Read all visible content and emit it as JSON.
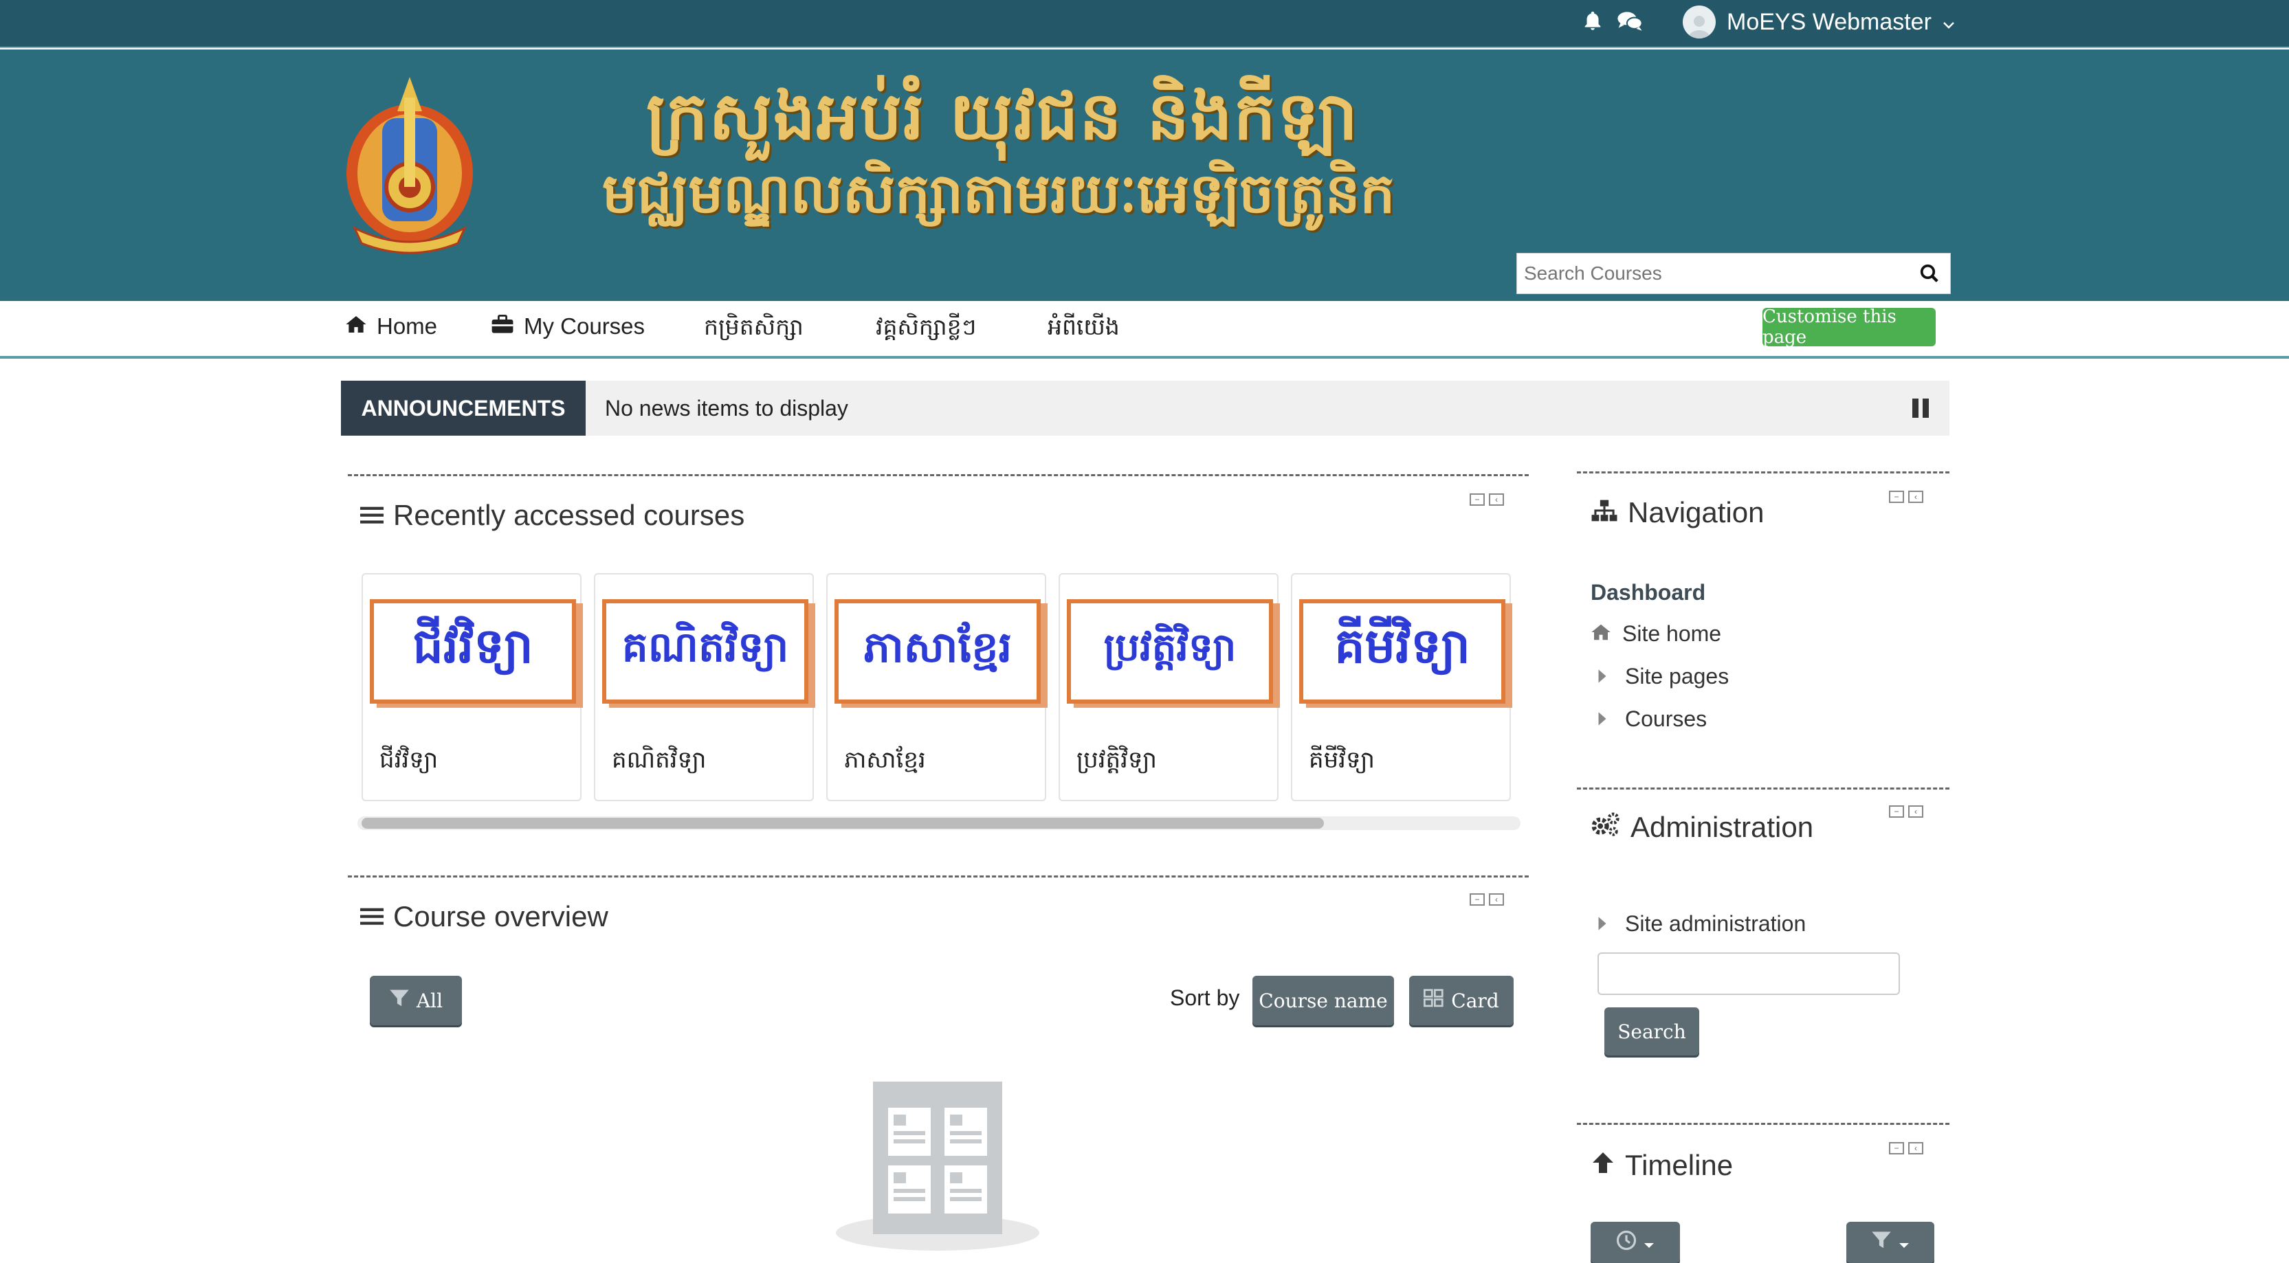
{
  "topbar": {
    "user_name": "MoEYS Webmaster",
    "bell_icon": "bell-icon",
    "messages_icon": "messages-icon"
  },
  "banner": {
    "title_line1": "ក្រសួងអប់រំ យុវជន និងកីឡា",
    "title_line2": "មជ្ឈមណ្ឌលសិក្សាតាមរយៈអេឡិចត្រូនិក",
    "search_placeholder": "Search Courses"
  },
  "nav": {
    "home": "Home",
    "my_courses": "My Courses",
    "item3": "កម្រិតសិក្សា",
    "item4": "វគ្គសិក្សាខ្លីៗ",
    "item5": "អំពីយើង",
    "customise": "Customise this page"
  },
  "announcements": {
    "label": "ANNOUNCEMENTS",
    "text": "No news items to display"
  },
  "recent": {
    "title": "Recently accessed courses",
    "courses": [
      {
        "art": "ជីវវិទ្យា",
        "name": "ជីវវិទ្យា"
      },
      {
        "art": "គណិតវិទ្យា",
        "name": "គណិតវិទ្យា"
      },
      {
        "art": "ភាសាខ្មែរ",
        "name": "ភាសាខ្មែរ"
      },
      {
        "art": "ប្រវត្តិវិទ្យា",
        "name": "ប្រវត្តិវិទ្យា"
      },
      {
        "art": "គីមីវិទ្យា",
        "name": "គីមីវិទ្យា"
      }
    ]
  },
  "overview": {
    "title": "Course overview",
    "filter_label": "All",
    "sort_by": "Sort by",
    "sort_value": "Course name",
    "view_value": "Card"
  },
  "navigation": {
    "title": "Navigation",
    "dashboard": "Dashboard",
    "site_home": "Site home",
    "site_pages": "Site pages",
    "courses": "Courses"
  },
  "administration": {
    "title": "Administration",
    "site_admin": "Site administration",
    "search_button": "Search"
  },
  "timeline": {
    "title": "Timeline"
  },
  "colors": {
    "topbar": "#245868",
    "banner": "#2b6d7c",
    "title_gold": "#e9c46a",
    "customise_green": "#4caf50",
    "dark_button": "#5d6b73",
    "course_art_border": "#e07b3a",
    "course_art_text": "#2c3ad6"
  }
}
